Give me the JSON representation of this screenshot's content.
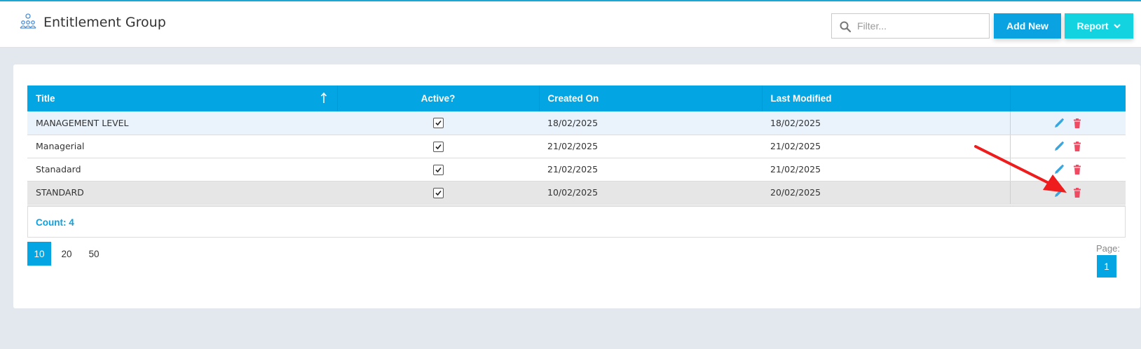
{
  "header": {
    "title": "Entitlement Group",
    "filter_placeholder": "Filter...",
    "add_label": "Add New",
    "report_label": "Report",
    "accent": "#03a6e3",
    "report_color": "#14d3e0"
  },
  "table": {
    "columns": [
      "Title",
      "Active?",
      "Created On",
      "Last Modified"
    ],
    "rows": [
      {
        "title": "MANAGEMENT LEVEL",
        "active": true,
        "created": "18/02/2025",
        "modified": "18/02/2025"
      },
      {
        "title": "Managerial",
        "active": true,
        "created": "21/02/2025",
        "modified": "21/02/2025"
      },
      {
        "title": "Stanadard",
        "active": true,
        "created": "21/02/2025",
        "modified": "21/02/2025"
      },
      {
        "title": "STANDARD",
        "active": true,
        "created": "10/02/2025",
        "modified": "20/02/2025"
      }
    ],
    "count_label": "Count: 4"
  },
  "pager": {
    "sizes": [
      "10",
      "20",
      "50"
    ],
    "active_size": "10",
    "page_label": "Page:",
    "current_page": "1"
  },
  "icons": {
    "edit": "pencil-icon",
    "delete": "trash-icon",
    "edit_color": "#3aa6dd",
    "delete_color": "#f04a63",
    "annotation_arrow_color": "#ee1c1c"
  }
}
